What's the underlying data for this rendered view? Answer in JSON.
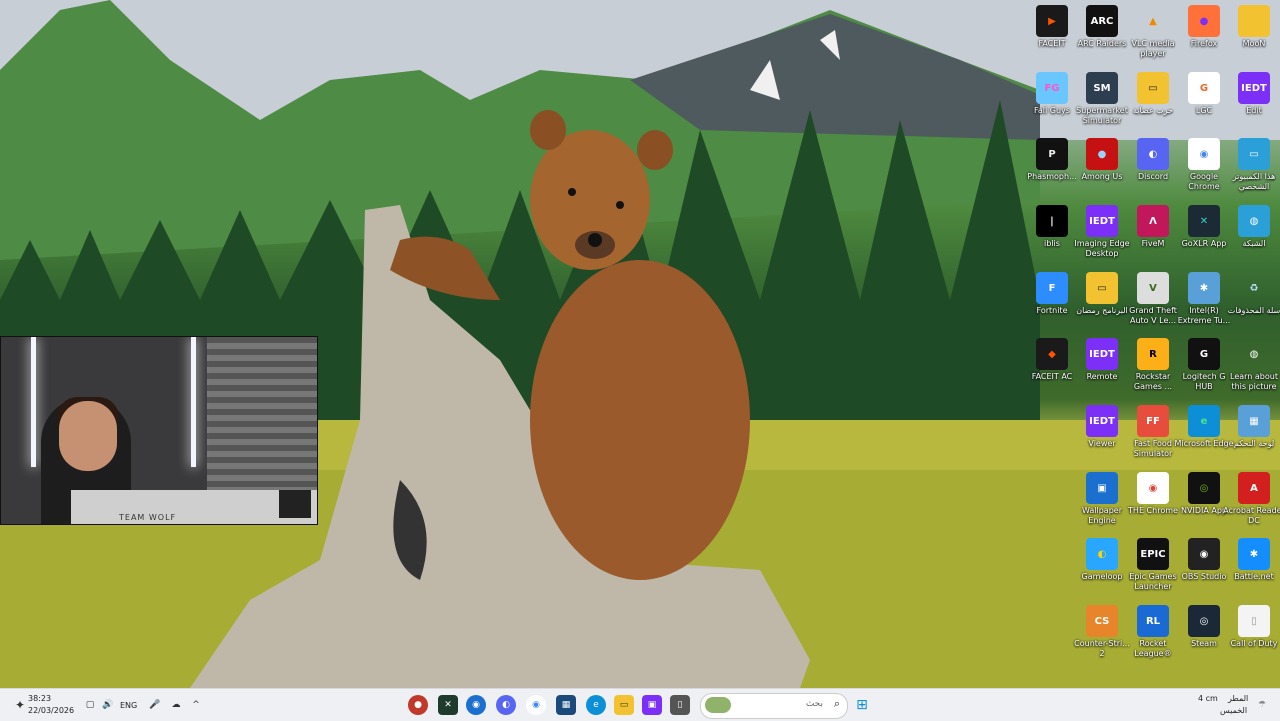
{
  "desktop": {
    "icons": [
      {
        "label": "FACEIT",
        "color": "#1a1a1a",
        "glyph": "▶",
        "gcolor": "#ff5500"
      },
      {
        "label": "ARC Raiders",
        "color": "#111",
        "glyph": "ARC",
        "gcolor": "#fff"
      },
      {
        "label": "VLC media player",
        "color": "transparent",
        "glyph": "▲",
        "gcolor": "#f08a00"
      },
      {
        "label": "Firefox",
        "color": "#ff7139",
        "glyph": "●",
        "gcolor": "#7b2ff7"
      },
      {
        "label": "MooN",
        "color": "#f2c230",
        "glyph": "",
        "gcolor": "#fff"
      },
      {
        "label": "Fall Guys",
        "color": "#6ac6ff",
        "glyph": "FG",
        "gcolor": "#ff56c8"
      },
      {
        "label": "Supermarket Simulator",
        "color": "#2c3e50",
        "glyph": "SM",
        "gcolor": "#fff"
      },
      {
        "label": "حرب عصابة",
        "color": "#f2c230",
        "glyph": "▭",
        "gcolor": "#222"
      },
      {
        "label": "LGC",
        "color": "#fff",
        "glyph": "G",
        "gcolor": "#f26522"
      },
      {
        "label": "Edit",
        "color": "#7b2ff7",
        "glyph": "IEDT",
        "gcolor": "#fff"
      },
      {
        "label": "Phasmoph...",
        "color": "#111",
        "glyph": "P",
        "gcolor": "#eee"
      },
      {
        "label": "Among Us",
        "color": "#c51111",
        "glyph": "●",
        "gcolor": "#9bd3f5"
      },
      {
        "label": "Discord",
        "color": "#5865f2",
        "glyph": "◐",
        "gcolor": "#fff"
      },
      {
        "label": "Google Chrome",
        "color": "#fff",
        "glyph": "◉",
        "gcolor": "#4285f4"
      },
      {
        "label": "هذا الكمبيوتر الشخصي",
        "color": "#2a9fd8",
        "glyph": "▭",
        "gcolor": "#fff"
      },
      {
        "label": "iblis",
        "color": "#000",
        "glyph": "|",
        "gcolor": "#fff"
      },
      {
        "label": "Imaging Edge Desktop",
        "color": "#7b2ff7",
        "glyph": "IEDT",
        "gcolor": "#fff"
      },
      {
        "label": "FiveM",
        "color": "#c2185b",
        "glyph": "Λ",
        "gcolor": "#fff"
      },
      {
        "label": "GoXLR App",
        "color": "#1b2a35",
        "glyph": "✕",
        "gcolor": "#38d1c4"
      },
      {
        "label": "الشبكة",
        "color": "#2a9fd8",
        "glyph": "◍",
        "gcolor": "#fff"
      },
      {
        "label": "Fortnite",
        "color": "#2d8cff",
        "glyph": "F",
        "gcolor": "#fff"
      },
      {
        "label": "البرنامج رمضان",
        "color": "#f2c230",
        "glyph": "▭",
        "gcolor": "#222"
      },
      {
        "label": "Grand Theft Auto V Le...",
        "color": "#ddd",
        "glyph": "V",
        "gcolor": "#3a6b1a"
      },
      {
        "label": "Intel(R) Extreme Tu...",
        "color": "#5aa0d8",
        "glyph": "✱",
        "gcolor": "#fff"
      },
      {
        "label": "سلة المحذوفات",
        "color": "transparent",
        "glyph": "♻",
        "gcolor": "#bfe3ff"
      },
      {
        "label": "FACEIT AC",
        "color": "#1a1a1a",
        "glyph": "◆",
        "gcolor": "#ff5500"
      },
      {
        "label": "Remote",
        "color": "#7b2ff7",
        "glyph": "IEDT",
        "gcolor": "#fff"
      },
      {
        "label": "Rockstar Games ...",
        "color": "#fcaf17",
        "glyph": "R",
        "gcolor": "#000"
      },
      {
        "label": "Logitech G HUB",
        "color": "#111",
        "glyph": "G",
        "gcolor": "#fff"
      },
      {
        "label": "Learn about this picture",
        "color": "transparent",
        "glyph": "◍",
        "gcolor": "#fff"
      },
      {
        "label": "Viewer",
        "color": "#7b2ff7",
        "glyph": "IEDT",
        "gcolor": "#fff"
      },
      {
        "label": "Fast Food Simulator",
        "color": "#e74c3c",
        "glyph": "FF",
        "gcolor": "#fff"
      },
      {
        "label": "Microsoft Edge",
        "color": "#0c8fd6",
        "glyph": "e",
        "gcolor": "#4ce28a"
      },
      {
        "label": "لوحة التحكم",
        "color": "#5aa0d8",
        "glyph": "▦",
        "gcolor": "#fff"
      },
      {
        "label": "Wallpaper Engine",
        "color": "#1b6fcf",
        "glyph": "▣",
        "gcolor": "#fff"
      },
      {
        "label": "THE Chrome",
        "color": "#fff",
        "glyph": "◉",
        "gcolor": "#db4437"
      },
      {
        "label": "NVIDIA App",
        "color": "#111",
        "glyph": "◎",
        "gcolor": "#76b900"
      },
      {
        "label": "Acrobat Reader DC",
        "color": "#d41f1f",
        "glyph": "A",
        "gcolor": "#fff"
      },
      {
        "label": "Gameloop",
        "color": "#29a6ff",
        "glyph": "◐",
        "gcolor": "#ffd400"
      },
      {
        "label": "Epic Games Launcher",
        "color": "#111",
        "glyph": "EPIC",
        "gcolor": "#fff"
      },
      {
        "label": "OBS Studio",
        "color": "#222",
        "glyph": "◉",
        "gcolor": "#fff"
      },
      {
        "label": "Battle.net",
        "color": "#148eff",
        "glyph": "✱",
        "gcolor": "#fff"
      },
      {
        "label": "Counter-Stri... 2",
        "color": "#e8852b",
        "glyph": "CS",
        "gcolor": "#fff"
      },
      {
        "label": "Rocket League®",
        "color": "#1a6ad6",
        "glyph": "RL",
        "gcolor": "#fff"
      },
      {
        "label": "Steam",
        "color": "#1b2838",
        "glyph": "◎",
        "gcolor": "#fff"
      },
      {
        "label": "Call of Duty",
        "color": "#f4f4f4",
        "glyph": "▯",
        "gcolor": "#999"
      }
    ]
  },
  "webcam": {
    "team_text": "TEAM WOLF"
  },
  "taskbar": {
    "time": "38:23",
    "date": "22/03/2026",
    "lang": "ENG",
    "search_placeholder": "بحث",
    "weather_temp": "4 cm",
    "weather_condition": "المطر",
    "weather_day": "الخميس"
  }
}
